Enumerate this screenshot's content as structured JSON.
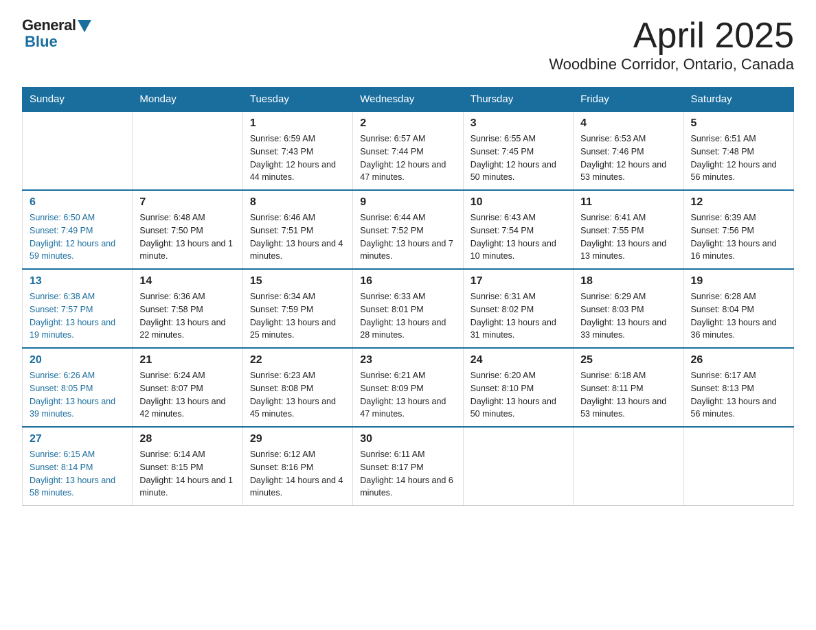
{
  "logo": {
    "text_general": "General",
    "text_blue": "Blue"
  },
  "header": {
    "title": "April 2025",
    "location": "Woodbine Corridor, Ontario, Canada"
  },
  "weekdays": [
    "Sunday",
    "Monday",
    "Tuesday",
    "Wednesday",
    "Thursday",
    "Friday",
    "Saturday"
  ],
  "weeks": [
    [
      {
        "day": "",
        "sunrise": "",
        "sunset": "",
        "daylight": ""
      },
      {
        "day": "",
        "sunrise": "",
        "sunset": "",
        "daylight": ""
      },
      {
        "day": "1",
        "sunrise": "Sunrise: 6:59 AM",
        "sunset": "Sunset: 7:43 PM",
        "daylight": "Daylight: 12 hours and 44 minutes."
      },
      {
        "day": "2",
        "sunrise": "Sunrise: 6:57 AM",
        "sunset": "Sunset: 7:44 PM",
        "daylight": "Daylight: 12 hours and 47 minutes."
      },
      {
        "day": "3",
        "sunrise": "Sunrise: 6:55 AM",
        "sunset": "Sunset: 7:45 PM",
        "daylight": "Daylight: 12 hours and 50 minutes."
      },
      {
        "day": "4",
        "sunrise": "Sunrise: 6:53 AM",
        "sunset": "Sunset: 7:46 PM",
        "daylight": "Daylight: 12 hours and 53 minutes."
      },
      {
        "day": "5",
        "sunrise": "Sunrise: 6:51 AM",
        "sunset": "Sunset: 7:48 PM",
        "daylight": "Daylight: 12 hours and 56 minutes."
      }
    ],
    [
      {
        "day": "6",
        "sunrise": "Sunrise: 6:50 AM",
        "sunset": "Sunset: 7:49 PM",
        "daylight": "Daylight: 12 hours and 59 minutes."
      },
      {
        "day": "7",
        "sunrise": "Sunrise: 6:48 AM",
        "sunset": "Sunset: 7:50 PM",
        "daylight": "Daylight: 13 hours and 1 minute."
      },
      {
        "day": "8",
        "sunrise": "Sunrise: 6:46 AM",
        "sunset": "Sunset: 7:51 PM",
        "daylight": "Daylight: 13 hours and 4 minutes."
      },
      {
        "day": "9",
        "sunrise": "Sunrise: 6:44 AM",
        "sunset": "Sunset: 7:52 PM",
        "daylight": "Daylight: 13 hours and 7 minutes."
      },
      {
        "day": "10",
        "sunrise": "Sunrise: 6:43 AM",
        "sunset": "Sunset: 7:54 PM",
        "daylight": "Daylight: 13 hours and 10 minutes."
      },
      {
        "day": "11",
        "sunrise": "Sunrise: 6:41 AM",
        "sunset": "Sunset: 7:55 PM",
        "daylight": "Daylight: 13 hours and 13 minutes."
      },
      {
        "day": "12",
        "sunrise": "Sunrise: 6:39 AM",
        "sunset": "Sunset: 7:56 PM",
        "daylight": "Daylight: 13 hours and 16 minutes."
      }
    ],
    [
      {
        "day": "13",
        "sunrise": "Sunrise: 6:38 AM",
        "sunset": "Sunset: 7:57 PM",
        "daylight": "Daylight: 13 hours and 19 minutes."
      },
      {
        "day": "14",
        "sunrise": "Sunrise: 6:36 AM",
        "sunset": "Sunset: 7:58 PM",
        "daylight": "Daylight: 13 hours and 22 minutes."
      },
      {
        "day": "15",
        "sunrise": "Sunrise: 6:34 AM",
        "sunset": "Sunset: 7:59 PM",
        "daylight": "Daylight: 13 hours and 25 minutes."
      },
      {
        "day": "16",
        "sunrise": "Sunrise: 6:33 AM",
        "sunset": "Sunset: 8:01 PM",
        "daylight": "Daylight: 13 hours and 28 minutes."
      },
      {
        "day": "17",
        "sunrise": "Sunrise: 6:31 AM",
        "sunset": "Sunset: 8:02 PM",
        "daylight": "Daylight: 13 hours and 31 minutes."
      },
      {
        "day": "18",
        "sunrise": "Sunrise: 6:29 AM",
        "sunset": "Sunset: 8:03 PM",
        "daylight": "Daylight: 13 hours and 33 minutes."
      },
      {
        "day": "19",
        "sunrise": "Sunrise: 6:28 AM",
        "sunset": "Sunset: 8:04 PM",
        "daylight": "Daylight: 13 hours and 36 minutes."
      }
    ],
    [
      {
        "day": "20",
        "sunrise": "Sunrise: 6:26 AM",
        "sunset": "Sunset: 8:05 PM",
        "daylight": "Daylight: 13 hours and 39 minutes."
      },
      {
        "day": "21",
        "sunrise": "Sunrise: 6:24 AM",
        "sunset": "Sunset: 8:07 PM",
        "daylight": "Daylight: 13 hours and 42 minutes."
      },
      {
        "day": "22",
        "sunrise": "Sunrise: 6:23 AM",
        "sunset": "Sunset: 8:08 PM",
        "daylight": "Daylight: 13 hours and 45 minutes."
      },
      {
        "day": "23",
        "sunrise": "Sunrise: 6:21 AM",
        "sunset": "Sunset: 8:09 PM",
        "daylight": "Daylight: 13 hours and 47 minutes."
      },
      {
        "day": "24",
        "sunrise": "Sunrise: 6:20 AM",
        "sunset": "Sunset: 8:10 PM",
        "daylight": "Daylight: 13 hours and 50 minutes."
      },
      {
        "day": "25",
        "sunrise": "Sunrise: 6:18 AM",
        "sunset": "Sunset: 8:11 PM",
        "daylight": "Daylight: 13 hours and 53 minutes."
      },
      {
        "day": "26",
        "sunrise": "Sunrise: 6:17 AM",
        "sunset": "Sunset: 8:13 PM",
        "daylight": "Daylight: 13 hours and 56 minutes."
      }
    ],
    [
      {
        "day": "27",
        "sunrise": "Sunrise: 6:15 AM",
        "sunset": "Sunset: 8:14 PM",
        "daylight": "Daylight: 13 hours and 58 minutes."
      },
      {
        "day": "28",
        "sunrise": "Sunrise: 6:14 AM",
        "sunset": "Sunset: 8:15 PM",
        "daylight": "Daylight: 14 hours and 1 minute."
      },
      {
        "day": "29",
        "sunrise": "Sunrise: 6:12 AM",
        "sunset": "Sunset: 8:16 PM",
        "daylight": "Daylight: 14 hours and 4 minutes."
      },
      {
        "day": "30",
        "sunrise": "Sunrise: 6:11 AM",
        "sunset": "Sunset: 8:17 PM",
        "daylight": "Daylight: 14 hours and 6 minutes."
      },
      {
        "day": "",
        "sunrise": "",
        "sunset": "",
        "daylight": ""
      },
      {
        "day": "",
        "sunrise": "",
        "sunset": "",
        "daylight": ""
      },
      {
        "day": "",
        "sunrise": "",
        "sunset": "",
        "daylight": ""
      }
    ]
  ]
}
